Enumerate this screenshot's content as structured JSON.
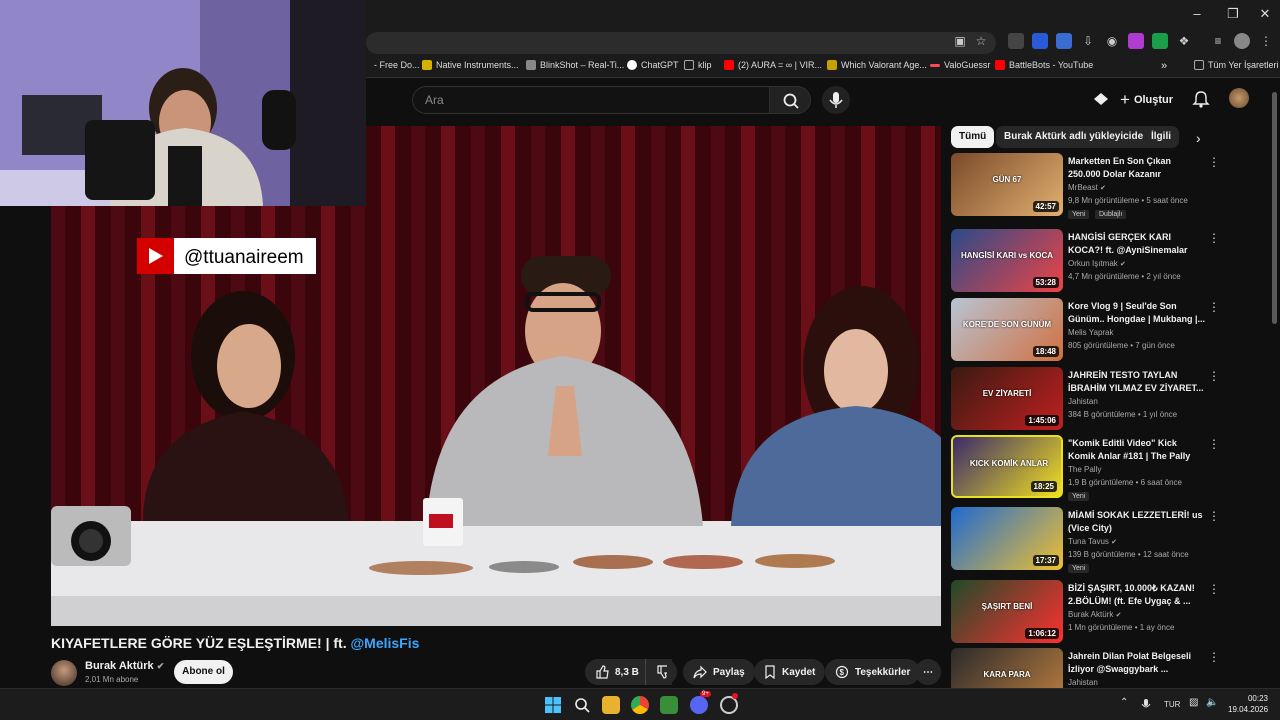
{
  "browser": {
    "bookmarks": [
      {
        "label": "- Free Do...",
        "color": "#777"
      },
      {
        "label": "Native Instruments...",
        "color": "#d4b000"
      },
      {
        "label": "BlinkShot – Real-Ti...",
        "color": "#888"
      },
      {
        "label": "ChatGPT",
        "color": "#ffffff"
      },
      {
        "label": "klip",
        "color": "#aaa"
      },
      {
        "label": "(2) AURA = ∞ | VIR...",
        "color": "#ff0000"
      },
      {
        "label": "Which Valorant Age...",
        "color": "#c8a000"
      },
      {
        "label": "ValoGuessr",
        "color": "#ff4655"
      },
      {
        "label": "BattleBots - YouTube",
        "color": "#ff0000"
      }
    ],
    "all_bookmarks": "Tüm Yer İşaretleri",
    "more": "»"
  },
  "header": {
    "search_placeholder": "Ara",
    "create_label": "Oluştur"
  },
  "video": {
    "overlay_handle": "@ttuanaireem",
    "title_main": "KIYAFETLERE GÖRE YÜZ EŞLEŞTİRME! | ft.",
    "title_mention": "@MelisFis",
    "channel": "Burak Aktürk",
    "subscribers": "2,01 Mn abone",
    "subscribe": "Abone ol",
    "likes": "8,3 B",
    "share": "Paylaş",
    "save": "Kaydet",
    "thanks": "Teşekkürler",
    "more": "⋯"
  },
  "chips": [
    {
      "label": "Tümü",
      "active": true
    },
    {
      "label": "Burak Aktürk adlı yükleyiciden",
      "active": false
    },
    {
      "label": "İlgili",
      "active": false
    }
  ],
  "recommendations": [
    {
      "title": "Marketten En Son Çıkan 250.000 Dolar Kazanır",
      "channel": "MrBeast",
      "verified": true,
      "meta": "9,8 Mn görüntüleme • 5 saat önce",
      "duration": "42:57",
      "badges": [
        "Yeni",
        "Dublajlı"
      ],
      "thumb_text": "GÜN 67"
    },
    {
      "title": "HANGİSİ GERÇEK KARI KOCA?! ft. @AyniSinemalar",
      "channel": "Orkun Işıtmak",
      "verified": true,
      "meta": "4,7 Mn görüntüleme • 2 yıl önce",
      "duration": "53:28",
      "badges": [],
      "thumb_text": "HANGİSİ KARI vs KOCA"
    },
    {
      "title": "Kore Vlog 9 | Seul'de Son Günüm.. Hongdae | Mukbang |...",
      "channel": "Melis Yaprak",
      "verified": false,
      "meta": "805 görüntüleme • 7 gün önce",
      "duration": "18:48",
      "badges": [],
      "thumb_text": "KORE'DE SON GÜNÜM"
    },
    {
      "title": "JAHREİN TESTO TAYLAN İBRAHİM YILMAZ EV ZİYARET...",
      "channel": "Jahistan",
      "verified": false,
      "meta": "384 B görüntüleme • 1 yıl önce",
      "duration": "1:45:06",
      "badges": [],
      "thumb_text": "EV ZİYARETİ"
    },
    {
      "title": "\"Komik Editli Video\" Kick Komik Anlar #181 | The Pally",
      "channel": "The Pally",
      "verified": false,
      "meta": "1,9 B görüntüleme • 6 saat önce",
      "duration": "18:25",
      "badges": [
        "Yeni"
      ],
      "thumb_text": "KICK KOMİK ANLAR"
    },
    {
      "title": "MİAMİ SOKAK LEZZETLERİ! us (Vice City)",
      "channel": "Tuna Tavus",
      "verified": true,
      "meta": "139 B görüntüleme • 12 saat önce",
      "duration": "17:37",
      "badges": [
        "Yeni"
      ],
      "thumb_text": ""
    },
    {
      "title": "BİZİ ŞAŞIRT, 10.000₺ KAZAN! 2.BÖLÜM! (ft. Efe Uygaç & ...",
      "channel": "Burak Aktürk",
      "verified": true,
      "meta": "1 Mn görüntüleme • 1 ay önce",
      "duration": "1:06:12",
      "badges": [],
      "thumb_text": "ŞAŞIRT BENİ"
    },
    {
      "title": "Jahrein Dilan Polat Belgeseli İzliyor @Swaggybark ...",
      "channel": "Jahistan",
      "verified": false,
      "meta": "",
      "duration": "",
      "badges": [],
      "thumb_text": "KARA PARA"
    }
  ],
  "taskbar": {
    "lang": "TUR",
    "time": "00:23",
    "date": "19.04.2026",
    "discord_badge": "9+"
  },
  "colors": {
    "bg": "#0f0f0f",
    "accent_link": "#3ea6ff",
    "chip_active": "#f1f1f1"
  }
}
